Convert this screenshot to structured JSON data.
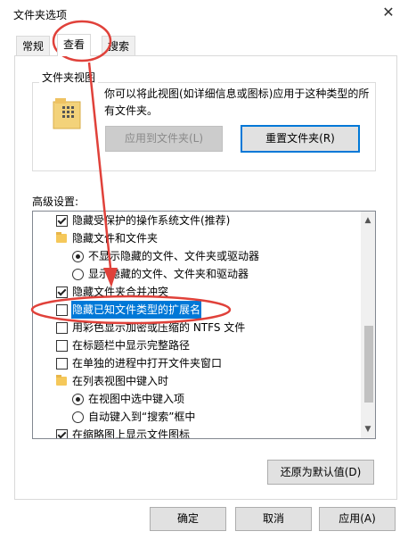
{
  "window": {
    "title": "文件夹选项",
    "close_symbol": "✕"
  },
  "tabs": [
    {
      "label": "常规"
    },
    {
      "label": "查看"
    },
    {
      "label": "搜索"
    }
  ],
  "folder_views": {
    "label": "文件夹视图",
    "description": "你可以将此视图(如详细信息或图标)应用于这种类型的所有文件夹。",
    "apply_button": "应用到文件夹(L)",
    "reset_button": "重置文件夹(R)"
  },
  "advanced": {
    "label": "高级设置:",
    "items": [
      {
        "kind": "checkbox",
        "checked": true,
        "indent": 0,
        "text": "隐藏受保护的操作系统文件(推荐)"
      },
      {
        "kind": "folder",
        "indent": 0,
        "text": "隐藏文件和文件夹"
      },
      {
        "kind": "radio",
        "checked": true,
        "indent": 1,
        "text": "不显示隐藏的文件、文件夹或驱动器"
      },
      {
        "kind": "radio",
        "checked": false,
        "indent": 1,
        "text": "显示隐藏的文件、文件夹和驱动器"
      },
      {
        "kind": "checkbox",
        "checked": true,
        "indent": 0,
        "text": "隐藏文件夹合并冲突"
      },
      {
        "kind": "checkbox",
        "checked": false,
        "indent": 0,
        "text": "隐藏已知文件类型的扩展名",
        "selected": true
      },
      {
        "kind": "checkbox",
        "checked": false,
        "indent": 0,
        "text": "用彩色显示加密或压缩的 NTFS 文件"
      },
      {
        "kind": "checkbox",
        "checked": false,
        "indent": 0,
        "text": "在标题栏中显示完整路径"
      },
      {
        "kind": "checkbox",
        "checked": false,
        "indent": 0,
        "text": "在单独的进程中打开文件夹窗口"
      },
      {
        "kind": "folder",
        "indent": 0,
        "text": "在列表视图中键入时"
      },
      {
        "kind": "radio",
        "checked": true,
        "indent": 1,
        "text": "在视图中选中键入项"
      },
      {
        "kind": "radio",
        "checked": false,
        "indent": 1,
        "text": "自动键入到“搜索”框中"
      },
      {
        "kind": "checkbox",
        "checked": true,
        "indent": 0,
        "text": "在缩略图上显示文件图标"
      }
    ]
  },
  "restore_button": "还原为默认值(D)",
  "footer": {
    "ok": "确定",
    "cancel": "取消",
    "apply": "应用(A)"
  },
  "colors": {
    "annotation": "#e0413a",
    "selection": "#0078d7"
  }
}
